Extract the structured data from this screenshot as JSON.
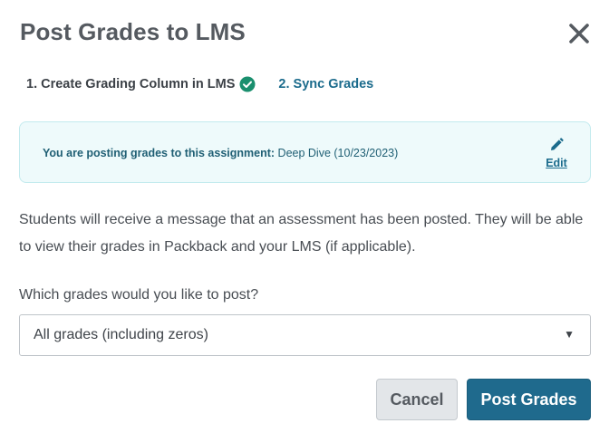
{
  "dialog": {
    "title": "Post Grades to LMS",
    "close_icon": "close-icon"
  },
  "steps": [
    {
      "label": "1. Create Grading Column in LMS",
      "status": "complete",
      "icon": "check-circle-icon"
    },
    {
      "label": "2. Sync Grades",
      "status": "active"
    }
  ],
  "info": {
    "prefix": "You are posting grades to this assignment:",
    "assignment": "Deep Dive (10/23/2023)",
    "edit_label": "Edit",
    "edit_icon": "pencil-icon"
  },
  "description": "Students will receive a message that an assessment has been posted. They will be able to view their grades in Packback and your LMS (if applicable).",
  "grades_select": {
    "question": "Which grades would you like to post?",
    "selected": "All grades (including zeros)",
    "caret": "▼"
  },
  "buttons": {
    "cancel": "Cancel",
    "post": "Post Grades"
  },
  "colors": {
    "accent": "#1f6a8d",
    "success": "#1a8f6e",
    "info_bg": "#eefafb"
  }
}
